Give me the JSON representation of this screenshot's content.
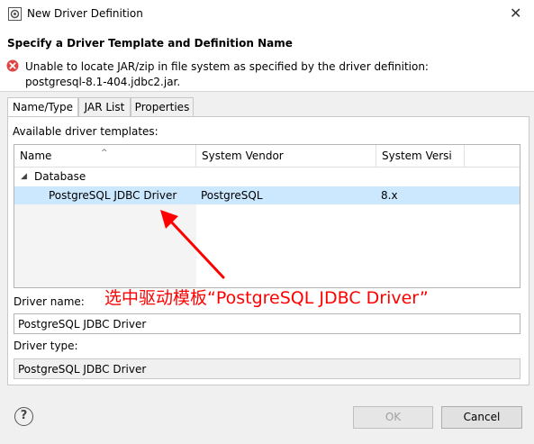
{
  "window": {
    "title": "New Driver Definition",
    "close_icon": "close-icon"
  },
  "header": {
    "title": "Specify a Driver Template and Definition Name",
    "error_message": "Unable to locate JAR/zip in file system as specified by the driver definition: postgresql-8.1-404.jdbc2.jar."
  },
  "tabs": [
    {
      "label": "Name/Type",
      "active": true
    },
    {
      "label": "JAR List",
      "active": false
    },
    {
      "label": "Properties",
      "active": false
    }
  ],
  "templates": {
    "label": "Available driver templates:",
    "columns": [
      "Name",
      "System Vendor",
      "System Versi"
    ],
    "group": "Database",
    "rows": [
      {
        "name": "PostgreSQL JDBC Driver",
        "vendor": "PostgreSQL",
        "version": "8.x",
        "selected": true
      }
    ]
  },
  "annotation": {
    "text": "选中驱动模板“PostgreSQL JDBC Driver”",
    "color": "#ff0000"
  },
  "fields": {
    "driver_name_label": "Driver name:",
    "driver_name_value": "PostgreSQL JDBC Driver",
    "driver_type_label": "Driver type:",
    "driver_type_value": "PostgreSQL JDBC Driver"
  },
  "buttons": {
    "ok": "OK",
    "cancel": "Cancel",
    "help": "?"
  },
  "colors": {
    "selection": "#cce8ff",
    "error": "#e04343"
  }
}
